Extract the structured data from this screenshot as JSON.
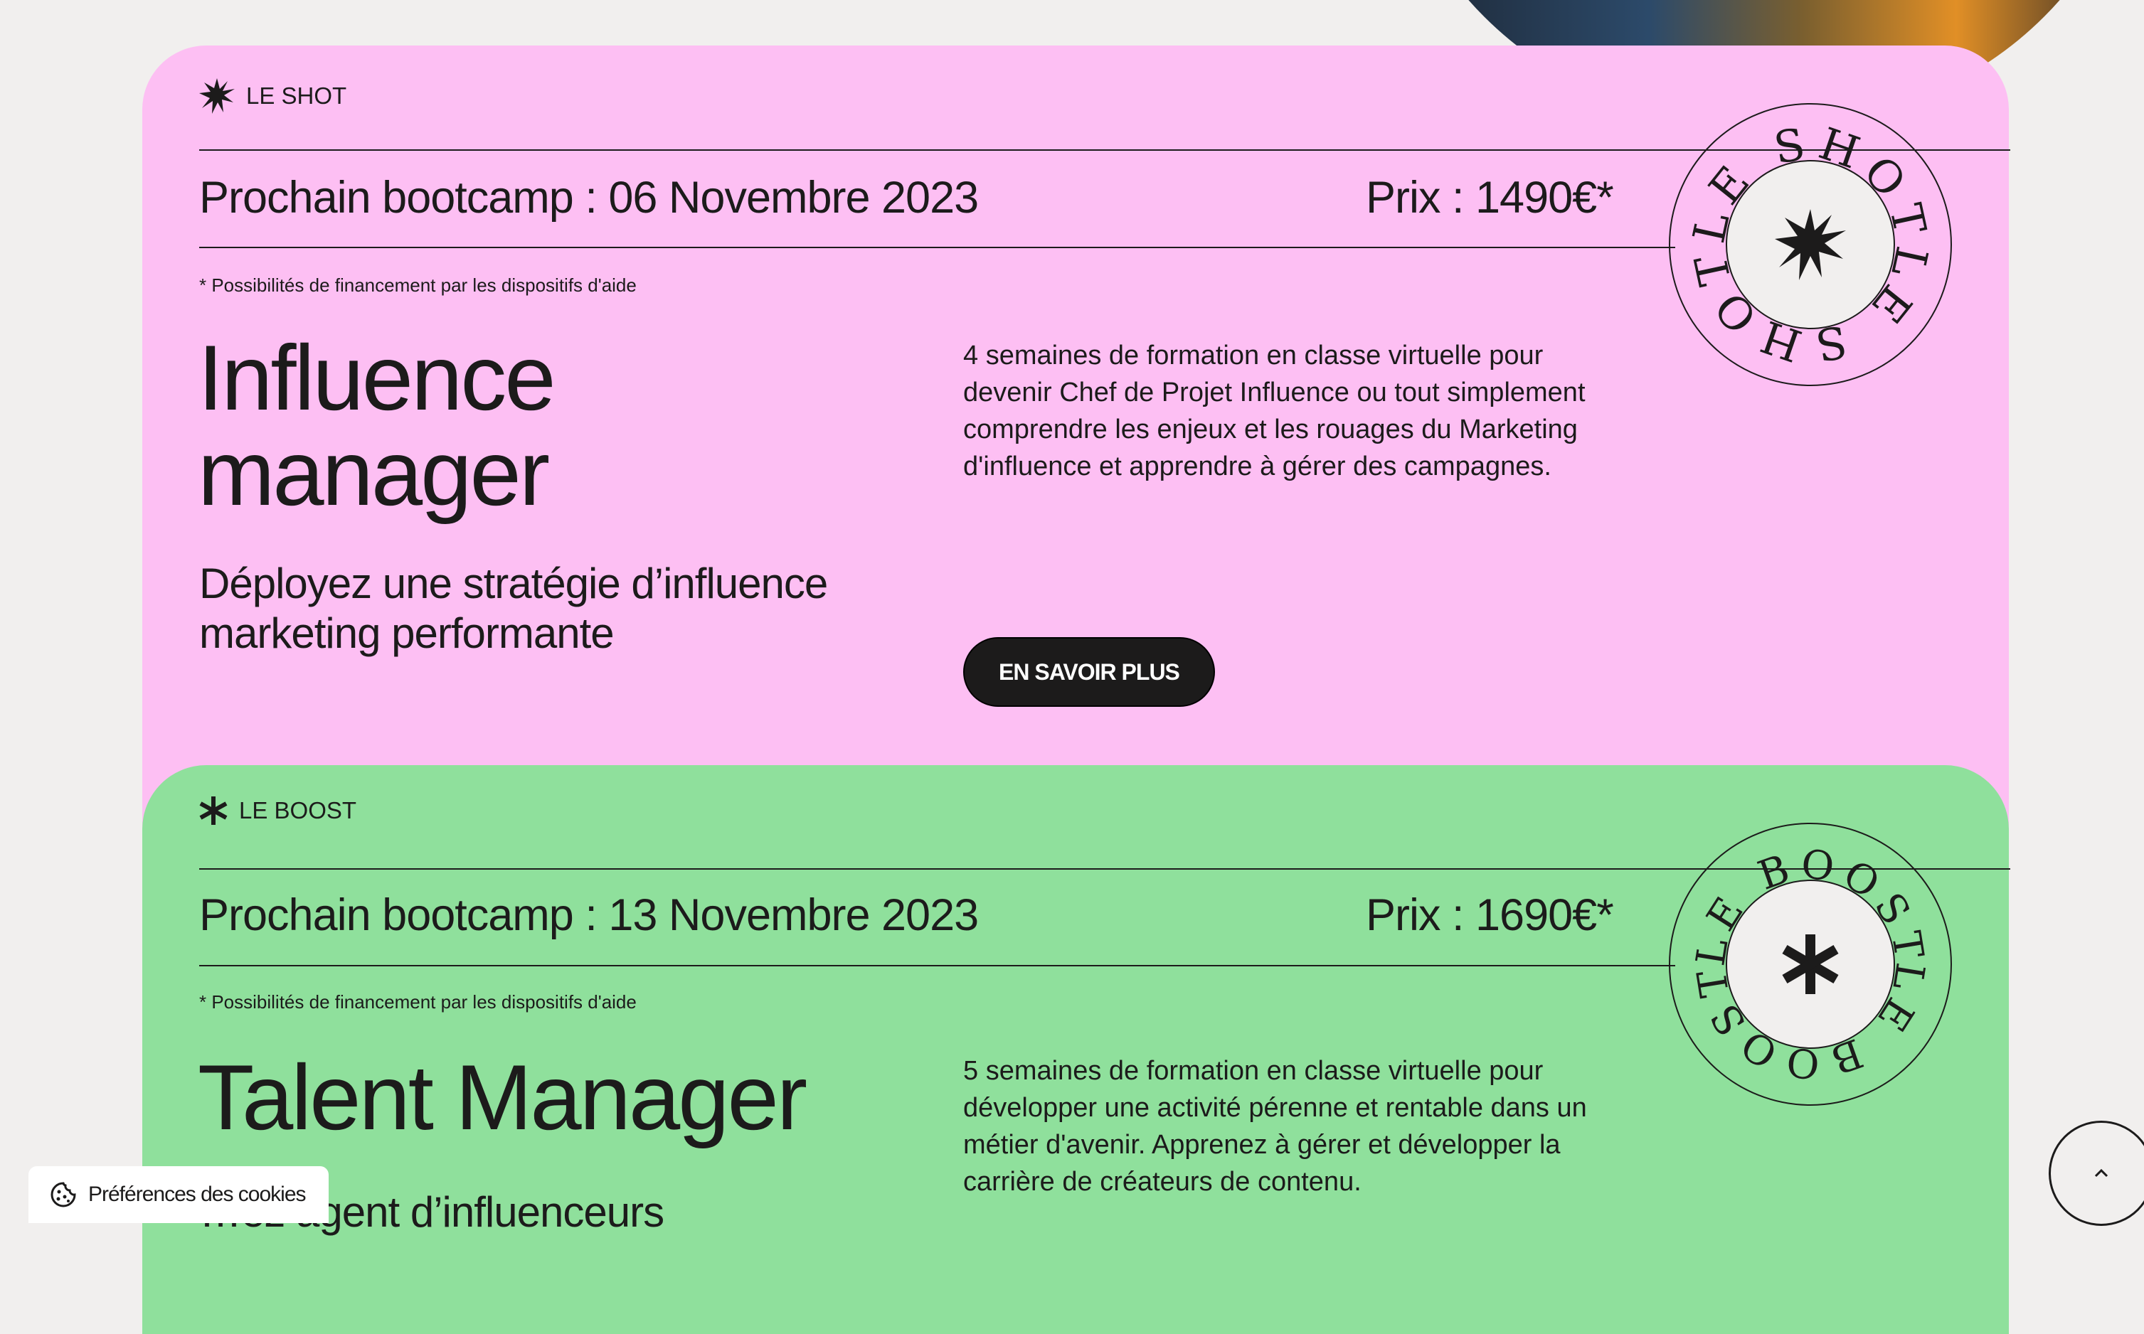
{
  "cookie_button": {
    "label": "Préférences des cookies"
  },
  "scroll_top": {
    "icon": "chevron-up-icon"
  },
  "colors": {
    "pink": "#fdbff3",
    "green": "#8fe09c",
    "dark": "#1c1b1b"
  },
  "cards": [
    {
      "tag": "LE SHOT",
      "icon": "starburst-icon",
      "headline": "Prochain bootcamp : 06 Novembre 2023",
      "price": "Prix : 1490€*",
      "finance_note": "* Possibilités de financement par les dispositifs d'aide",
      "title_line1": "Influence",
      "title_line2": "manager",
      "subtitle": "Déployez une stratégie d’influence marketing performante",
      "description": "4  semaines de formation en classe virtuelle pour devenir Chef de Projet Influence ou tout simplement comprendre les enjeux et les rouages du Marketing d'influence et apprendre à gérer des campagnes.",
      "cta": "EN SAVOIR PLUS",
      "seal_text": "LE SHOT"
    },
    {
      "tag": "LE BOOST",
      "icon": "asterisk-icon",
      "headline": "Prochain bootcamp : 13 Novembre 2023",
      "price": "Prix : 1690€*",
      "finance_note": "* Possibilités de financement par les dispositifs d'aide",
      "title_line1": "Talent Manager",
      "subtitle": "…ez agent d’influenceurs",
      "description": "5 semaines de formation en classe virtuelle pour développer une activité pérenne et rentable dans un métier d'avenir. Apprenez à gérer et développer la carrière de créateurs de contenu.",
      "seal_text": "LE BOOST"
    }
  ]
}
